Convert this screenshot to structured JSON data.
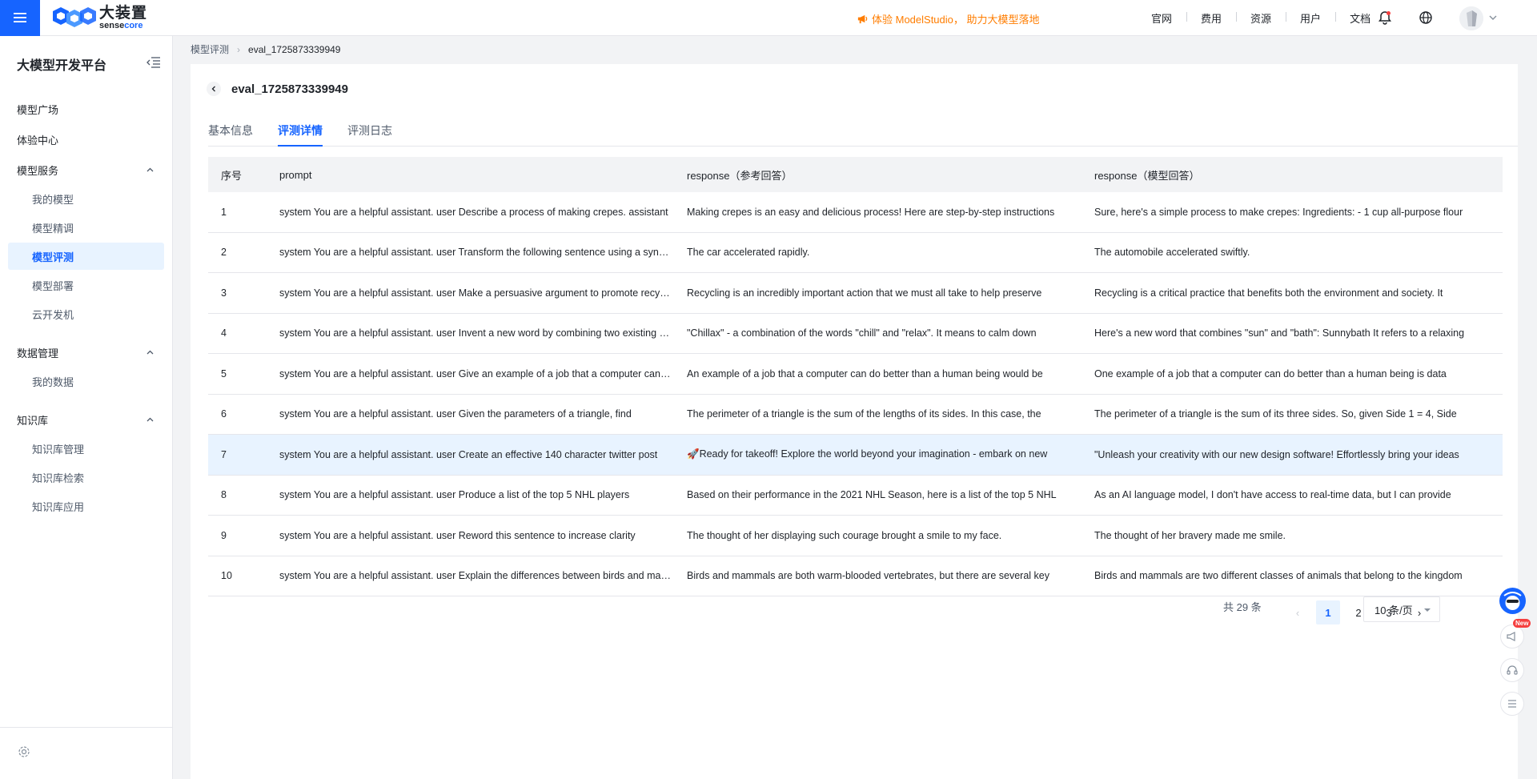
{
  "brand": {
    "logo_cn": "大装置",
    "logo_en_a": "sense",
    "logo_en_b": "core",
    "accent": "#1664ff"
  },
  "header": {
    "promo": "体验 ModelStudio，  助力大模型落地",
    "nav": [
      "官网",
      "费用",
      "资源",
      "用户",
      "文档"
    ]
  },
  "sidebar": {
    "title": "大模型开发平台",
    "items": [
      {
        "label": "模型广场"
      },
      {
        "label": "体验中心"
      },
      {
        "label": "模型服务"
      },
      {
        "label": "我的模型"
      },
      {
        "label": "模型精调"
      },
      {
        "label": "模型评测"
      },
      {
        "label": "模型部署"
      },
      {
        "label": "云开发机"
      },
      {
        "label": "数据管理"
      },
      {
        "label": "我的数据"
      },
      {
        "label": "知识库"
      },
      {
        "label": "知识库管理"
      },
      {
        "label": "知识库检索"
      },
      {
        "label": "知识库应用"
      }
    ]
  },
  "breadcrumb": {
    "parent": "模型评测",
    "current": "eval_1725873339949"
  },
  "page": {
    "title": "eval_1725873339949",
    "tabs": [
      "基本信息",
      "评测详情",
      "评测日志"
    ],
    "active_tab": "评测详情"
  },
  "table": {
    "columns": [
      "序号",
      "prompt",
      "response（参考回答）",
      "response（模型回答）"
    ],
    "rows": [
      {
        "idx": "1",
        "prompt": "system You are a helpful assistant. user Describe a process of making crepes. assistant",
        "ref": "Making crepes is an easy and delicious process! Here are step-by-step instructions",
        "model": "Sure, here's a simple process to make crepes: Ingredients: - 1 cup all-purpose flour"
      },
      {
        "idx": "2",
        "prompt": "system You are a helpful assistant. user Transform the following sentence using a synonym",
        "ref": "The car accelerated rapidly.",
        "model": "The automobile accelerated swiftly."
      },
      {
        "idx": "3",
        "prompt": "system You are a helpful assistant. user Make a persuasive argument to promote recycling",
        "ref": "Recycling is an incredibly important action that we must all take to help preserve",
        "model": "Recycling is a critical practice that benefits both the environment and society. It"
      },
      {
        "idx": "4",
        "prompt": "system You are a helpful assistant. user Invent a new word by combining two existing words",
        "ref": "\"Chillax\" - a combination of the words \"chill\" and \"relax\". It means to calm down",
        "model": "Here's a new word that combines \"sun\" and \"bath\": Sunnybath It refers to a relaxing"
      },
      {
        "idx": "5",
        "prompt": "system You are a helpful assistant. user Give an example of a job that a computer can do",
        "ref": "An example of a job that a computer can do better than a human being would be",
        "model": "One example of a job that a computer can do better than a human being is data"
      },
      {
        "idx": "6",
        "prompt": "system You are a helpful assistant. user Given the parameters of a triangle, find",
        "ref": "The perimeter of a triangle is the sum of the lengths of its sides. In this case, the",
        "model": "The perimeter of a triangle is the sum of its three sides. So, given Side 1 = 4, Side"
      },
      {
        "idx": "7",
        "prompt": "system You are a helpful assistant. user Create an effective 140 character twitter post",
        "ref": "🚀Ready for takeoff! Explore the world beyond your imagination - embark on new",
        "model": "\"Unleash your creativity with our new design software! Effortlessly bring your ideas"
      },
      {
        "idx": "8",
        "prompt": "system You are a helpful assistant. user Produce a list of the top 5 NHL players",
        "ref": "Based on their performance in the 2021 NHL Season, here is a list of the top 5 NHL",
        "model": "As an AI language model, I don't have access to real-time data, but I can provide"
      },
      {
        "idx": "9",
        "prompt": "system You are a helpful assistant. user Reword this sentence to increase clarity",
        "ref": "The thought of her displaying such courage brought a smile to my face.",
        "model": "The thought of her bravery made me smile."
      },
      {
        "idx": "10",
        "prompt": "system You are a helpful assistant. user Explain the differences between birds and mammals",
        "ref": "Birds and mammals are both warm-blooded vertebrates, but there are several key",
        "model": "Birds and mammals are two different classes of animals that belong to the kingdom"
      }
    ]
  },
  "pagination": {
    "total": "共 29 条",
    "pages": [
      "1",
      "2",
      "3"
    ],
    "current": "1",
    "page_size": "10 条/页"
  },
  "floating": {
    "new_badge": "New"
  }
}
